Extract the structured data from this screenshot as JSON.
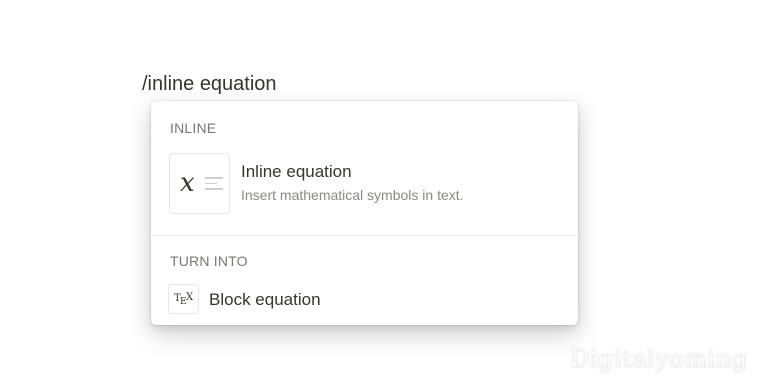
{
  "editor": {
    "command_text": "/inline equation"
  },
  "menu": {
    "sections": [
      {
        "header": "INLINE",
        "items": [
          {
            "icon": "inline-equation-icon",
            "glyph": "x",
            "title": "Inline equation",
            "description": "Insert mathematical symbols in text."
          }
        ]
      },
      {
        "header": "TURN INTO",
        "items": [
          {
            "icon": "tex-icon",
            "glyph_t": "T",
            "glyph_e": "E",
            "glyph_x": "X",
            "title": "Block equation"
          }
        ]
      }
    ]
  },
  "watermark": {
    "text": "Digitalyoming"
  },
  "colors": {
    "text": "#37352f",
    "muted": "#787774",
    "border": "#e6e6e4"
  }
}
